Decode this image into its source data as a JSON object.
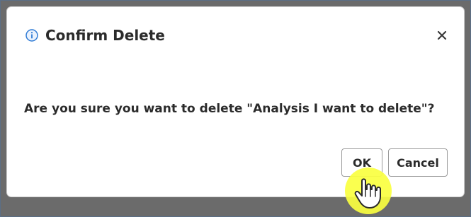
{
  "dialog": {
    "title": "Confirm Delete",
    "message": "Are you sure you want to delete \"Analysis I want to delete\"?",
    "ok_label": "OK",
    "cancel_label": "Cancel"
  },
  "icons": {
    "title_icon": "info-icon",
    "close_icon": "close-icon",
    "cursor_icon": "hand-pointer-icon"
  },
  "colors": {
    "info_blue": "#2f7bd5",
    "highlight_yellow": "#f7ff3a",
    "text": "#2b2b2b"
  }
}
